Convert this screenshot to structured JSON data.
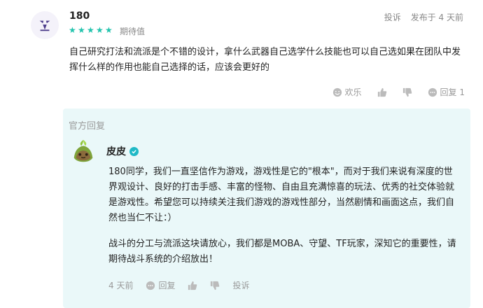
{
  "comment": {
    "username": "180",
    "rating_stars": 5,
    "rating_label": "期待值",
    "report_label": "投诉",
    "posted_label": "发布于 4 天前",
    "text": "自己研究打法和流派是个不错的设计，拿什么武器自己选学什么技能也可以自己选如果在团队中发挥什么样的作用也能自己选择的话，应该会更好的",
    "actions": {
      "happy_label": "欢乐",
      "reply_label": "回复 1"
    }
  },
  "official_reply": {
    "header": "官方回复",
    "name": "皮皮",
    "paragraph1": "180同学，我们一直坚信作为游戏，游戏性是它的\"根本\"，而对于我们来说有深度的世界观设计、良好的打击手感、丰富的怪物、自由且充满惊喜的玩法、优秀的社交体验就是游戏性。希望您可以持续关注我们游戏的游戏性部分，当然剧情和画面这点，我们自然也当仁不让：）",
    "paragraph2": "战斗的分工与流派这块请放心，我们都是MOBA、守望、TF玩家，深知它的重要性，请期待战斗系统的介绍放出！",
    "footer": {
      "time": "4 天前",
      "reply_label": "回复",
      "report_label": "投诉"
    }
  },
  "colors": {
    "star": "#22c3ad",
    "reply_bg": "#eaf8f9",
    "verified": "#1fb9c6"
  }
}
